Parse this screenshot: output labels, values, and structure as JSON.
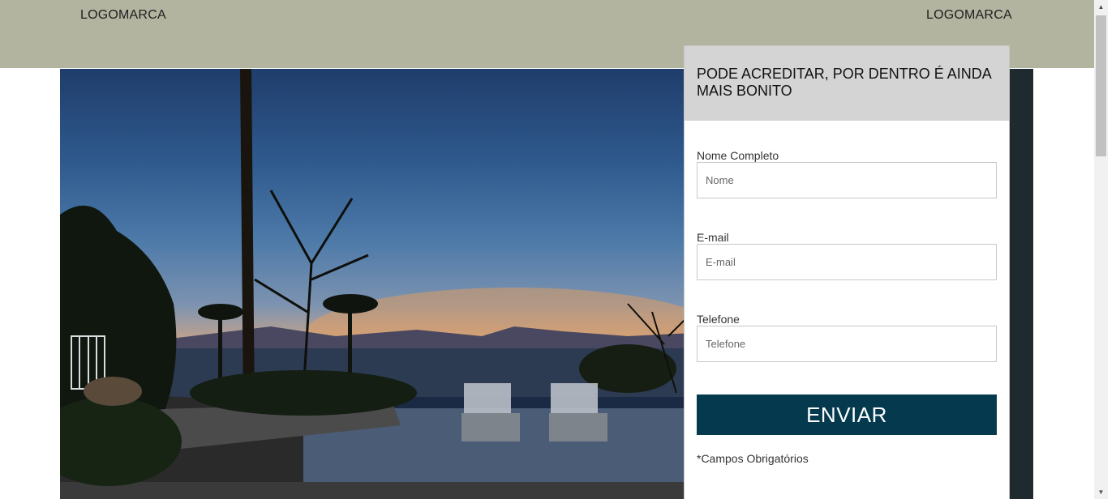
{
  "header": {
    "logo_left": "LOGOMARCA",
    "logo_right": "LOGOMARCA",
    "background_color": "#b3b4a0"
  },
  "hero": {
    "image_description_icon": "sunset-pool-photo"
  },
  "form": {
    "title": "PODE ACREDITAR, POR DENTRO É AINDA MAIS BONITO",
    "fields": [
      {
        "label": "Nome Completo",
        "placeholder": "Nome",
        "value": ""
      },
      {
        "label": "E-mail",
        "placeholder": "E-mail",
        "value": ""
      },
      {
        "label": "Telefone",
        "placeholder": "Telefone",
        "value": ""
      }
    ],
    "submit_label": "ENVIAR",
    "submit_color": "#053a4e",
    "note": "*Campos Obrigatórios"
  },
  "scrollbar": {
    "up_icon": "arrow-up-icon",
    "down_icon": "arrow-down-icon"
  }
}
